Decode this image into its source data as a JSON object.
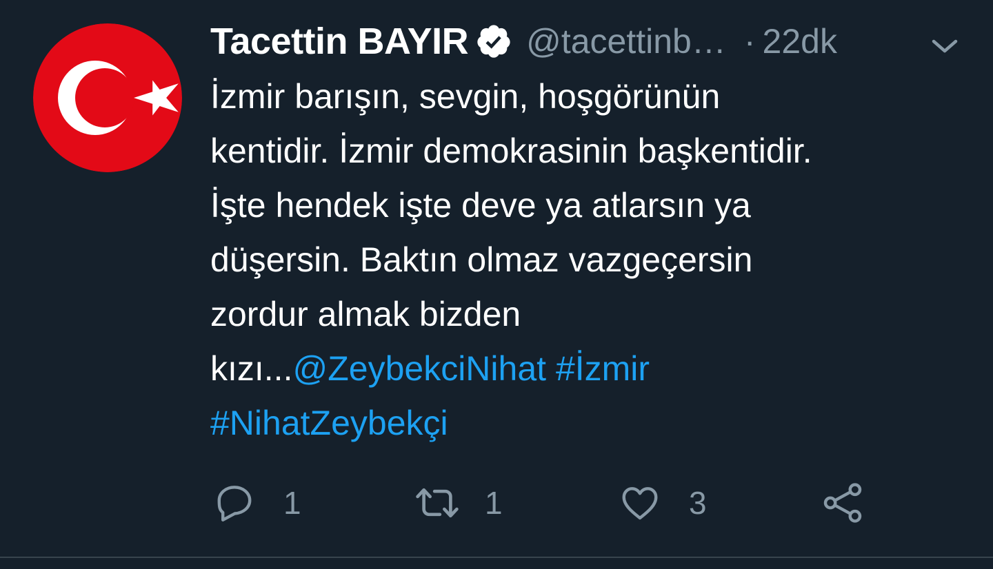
{
  "tweet": {
    "author": {
      "name": "Tacettin BAYIR",
      "handle": "@tacettinb…",
      "verified": true,
      "avatar": "turkish-flag-avatar"
    },
    "separator": "·",
    "time": "22dk",
    "text_lines": [
      "İzmir barışın, sevgin, hoşgörünün",
      "kentidir. İzmir demokrasinin başkentidir.",
      "İşte hendek işte deve ya atlarsın ya",
      "düşersin. Baktın olmaz vazgeçersin",
      "zordur almak bizden"
    ],
    "text_tail": "kızı...",
    "mention": "@ZeybekciNihat",
    "hashtags": [
      "#İzmir",
      "#NihatZeybekçi"
    ],
    "actions": {
      "reply": {
        "icon": "reply-icon",
        "count": "1"
      },
      "retweet": {
        "icon": "retweet-icon",
        "count": "1"
      },
      "like": {
        "icon": "heart-icon",
        "count": "3"
      },
      "share": {
        "icon": "share-icon"
      }
    },
    "more_icon": "chevron-down-icon"
  },
  "colors": {
    "background": "#15202b",
    "text": "#ffffff",
    "secondary": "#8899a6",
    "link": "#1da1f2",
    "flag_red": "#e30a17",
    "divider": "#38444d"
  }
}
